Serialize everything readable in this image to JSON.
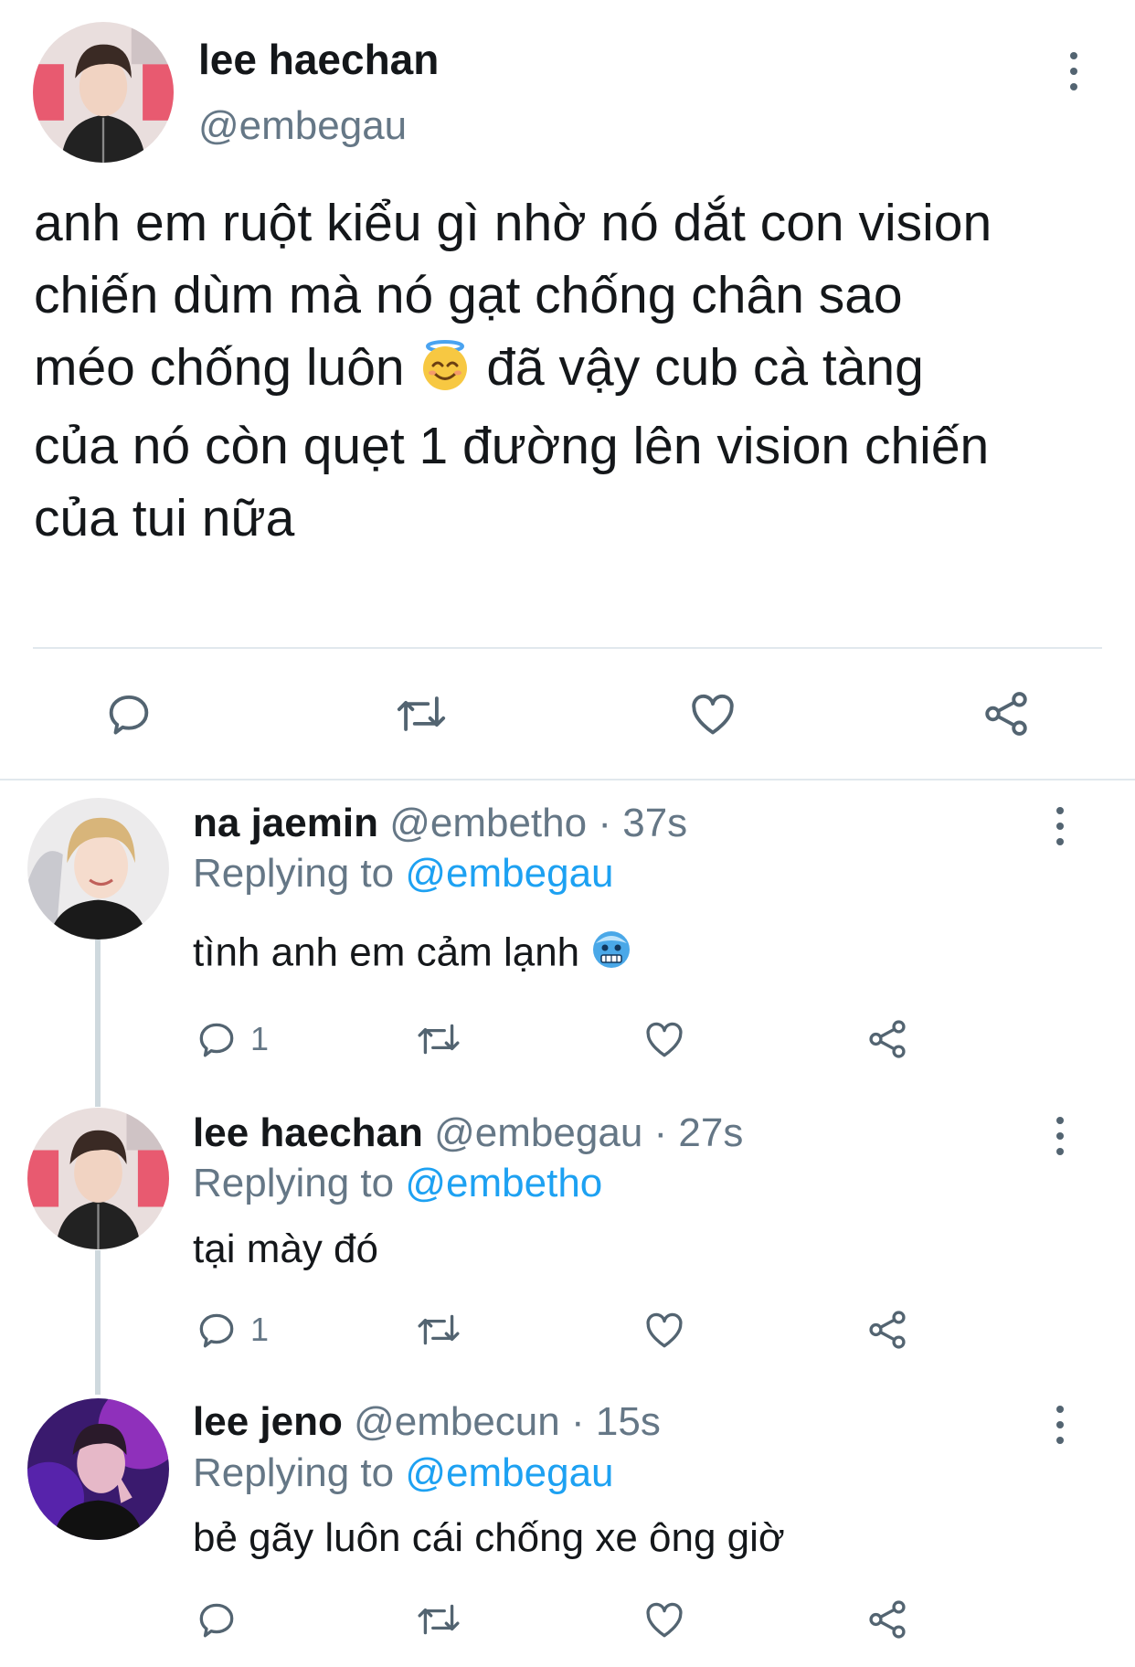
{
  "main_tweet": {
    "author_name": "lee haechan",
    "handle": "@embegau",
    "text_lines": [
      "anh em ruột kiểu gì nhờ nó dắt con vision",
      "chiến dùm mà nó gạt chống chân sao",
      "méo chống luôn",
      "đã vậy cub cà tàng",
      "của nó còn quẹt 1 đường lên vision chiến",
      "của tui nữa"
    ],
    "emoji": "smiling-face-with-halo",
    "actions": [
      "reply-icon",
      "retweet-icon",
      "like-icon",
      "share-icon"
    ]
  },
  "replies": [
    {
      "author_name": "na jaemin",
      "handle": "@embetho",
      "sep": "·",
      "time": "37s",
      "replying_label": "Replying to",
      "replying_to": "@embegau",
      "text": "tình anh em cảm lạnh",
      "emoji": "cold-face",
      "reply_count": "1"
    },
    {
      "author_name": "lee haechan",
      "handle": "@embegau",
      "sep": "·",
      "time": "27s",
      "replying_label": "Replying to",
      "replying_to": "@embetho",
      "text": "tại mày đó",
      "reply_count": "1"
    },
    {
      "author_name": "lee jeno",
      "handle": "@embecun",
      "sep": "·",
      "time": "15s",
      "replying_label": "Replying to",
      "replying_to": "@embegau",
      "text": "bẻ gãy luôn cái chống xe ông giờ"
    }
  ],
  "colors": {
    "text": "#14171a",
    "secondary": "#657786",
    "link": "#1da1f2",
    "divider": "#e1e8ed",
    "thread_line": "#cfd9de",
    "icon": "#536471"
  }
}
